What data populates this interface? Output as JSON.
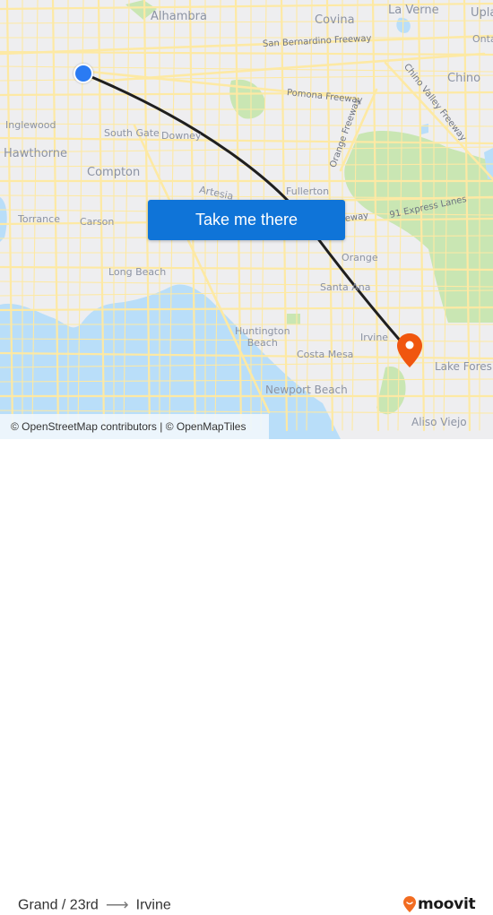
{
  "map": {
    "colors": {
      "land": "#eeeef0",
      "water": "#b9def9",
      "park": "#c9e6b3",
      "road": "#fde9a4",
      "route_line": "#1f1f1f",
      "origin_dot": "#2a7bf3",
      "destination_pin": "#f0560f"
    },
    "places": [
      {
        "id": "alhambra",
        "label": "Alhambra"
      },
      {
        "id": "covina",
        "label": "Covina"
      },
      {
        "id": "la-verne",
        "label": "La Verne"
      },
      {
        "id": "upland",
        "label": "Upla"
      },
      {
        "id": "ontario",
        "label": "Onta"
      },
      {
        "id": "chino",
        "label": "Chino"
      },
      {
        "id": "inglewood",
        "label": "Inglewood"
      },
      {
        "id": "south-gate",
        "label": "South Gate"
      },
      {
        "id": "downey",
        "label": "Downey"
      },
      {
        "id": "hawthorne",
        "label": "Hawthorne"
      },
      {
        "id": "compton",
        "label": "Compton"
      },
      {
        "id": "artesia",
        "label": "Artesia"
      },
      {
        "id": "fullerton",
        "label": "Fullerton"
      },
      {
        "id": "torrance",
        "label": "Torrance"
      },
      {
        "id": "carson",
        "label": "Carson"
      },
      {
        "id": "orange",
        "label": "Orange"
      },
      {
        "id": "long-beach",
        "label": "Long Beach"
      },
      {
        "id": "santa-ana",
        "label": "Santa Ana"
      },
      {
        "id": "huntington-beach",
        "label": "Huntington\nBeach"
      },
      {
        "id": "irvine",
        "label": "Irvine"
      },
      {
        "id": "costa-mesa",
        "label": "Costa Mesa"
      },
      {
        "id": "lake-forest",
        "label": "Lake Fores"
      },
      {
        "id": "newport-beach",
        "label": "Newport Beach"
      },
      {
        "id": "aliso-viejo",
        "label": "Aliso Viejo"
      }
    ],
    "roads": [
      {
        "id": "san-bernardino-fwy",
        "label": "San Bernardino Freeway"
      },
      {
        "id": "pomona-fwy",
        "label": "Pomona Freeway"
      },
      {
        "id": "chino-valley-fwy",
        "label": "Chino Valley Freeway"
      },
      {
        "id": "orange-fwy",
        "label": "Orange Freeway"
      },
      {
        "id": "91-express",
        "label": "91 Express Lanes"
      },
      {
        "id": "freeway-partial",
        "label": "eway"
      }
    ],
    "origin_icon": "origin-dot-icon",
    "destination_icon": "map-pin-icon",
    "attribution": "© OpenStreetMap contributors | © OpenMapTiles"
  },
  "cta": {
    "label": "Take me there"
  },
  "footer": {
    "origin": "Grand / 23rd",
    "arrow_icon": "arrow-right-icon",
    "destination": "Irvine",
    "logo_text": "moovit",
    "logo_icon": "moovit-pin-icon"
  }
}
